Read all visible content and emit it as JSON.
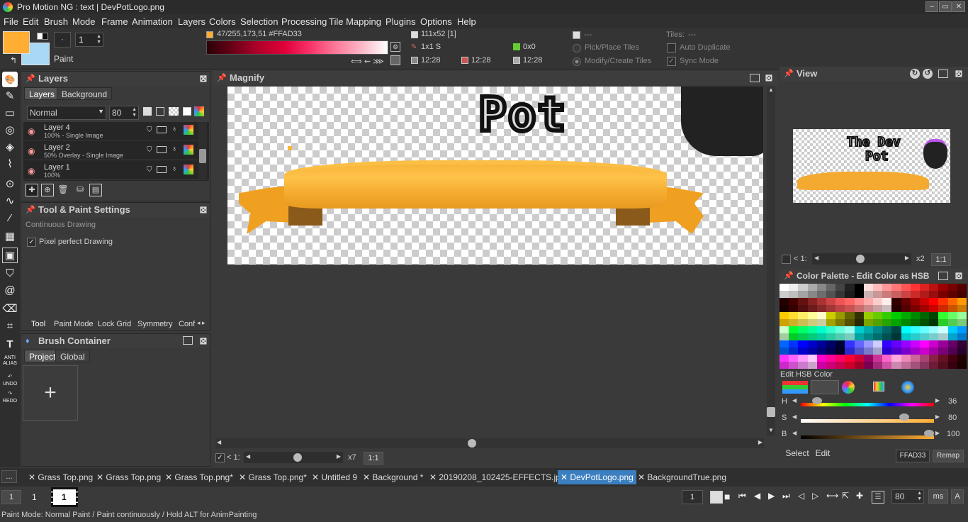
{
  "window": {
    "title": "Pro Motion NG : text | DevPotLogo.png"
  },
  "menu": [
    "File",
    "Edit",
    "Brush",
    "Mode",
    "Frame",
    "Animation",
    "Layers",
    "Colors",
    "Selection",
    "Processing",
    "Tile Mapping",
    "Plugins",
    "Options",
    "Help"
  ],
  "toolbar": {
    "mode_label": "Paint",
    "brush_size": "1",
    "color_info": "47/255,173,51 #FFAD33",
    "canvas_size": "111x52 [1]",
    "brush_info": "1x1 S",
    "position": "0x0",
    "time1": "12:28",
    "time2": "12:28",
    "time3": "12:28",
    "dash1": "---",
    "tiles_label": "Tiles:",
    "tiles_value": "---",
    "pick_place_tiles": "Pick/Place Tiles",
    "modify_create_tiles": "Modify/Create Tiles",
    "auto_duplicate": "Auto Duplicate",
    "sync_mode": "Sync Mode",
    "fg_color": "#FFAD33",
    "bg_color": "#A9D8F5"
  },
  "layers_panel": {
    "title": "Layers",
    "tabs": [
      "Layers",
      "Background"
    ],
    "blend_mode": "Normal",
    "opacity": "80",
    "layers": [
      {
        "name": "Layer 4",
        "detail": "100% - Single Image"
      },
      {
        "name": "Layer 2",
        "detail": "50% Overlay - Single Image"
      },
      {
        "name": "Layer 1",
        "detail": "100%"
      }
    ]
  },
  "tool_settings": {
    "title": "Tool & Paint Settings",
    "subtitle": "Continuous Drawing",
    "pixel_perfect": "Pixel perfect Drawing",
    "tabs": [
      "Tool",
      "Paint Mode",
      "Lock Grid",
      "Symmetry",
      "Conf"
    ]
  },
  "brush_container": {
    "title": "Brush Container",
    "tabs": [
      "Project",
      "Global"
    ],
    "add": "+"
  },
  "magnify": {
    "title": "Magnify",
    "zoom_label": "< 1:",
    "zoom_value": "x7",
    "ratio": "1:1",
    "canvas_text": "Pot"
  },
  "view_panel": {
    "title": "View",
    "zoom_label": "< 1:",
    "zoom_value": "x2",
    "ratio": "1:1",
    "preview_text_1": "The Dev",
    "preview_text_2": "Pot"
  },
  "color_palette": {
    "title": "Color Palette - Edit Color as HSB",
    "edit_label": "Edit HSB Color",
    "h_label": "H",
    "h_value": "36",
    "h_frac": 0.1,
    "s_label": "S",
    "s_value": "80",
    "s_frac": 0.8,
    "b_label": "B",
    "b_value": "100",
    "b_frac": 1.0,
    "select": "Select",
    "edit": "Edit",
    "hex": "FFAD33",
    "remap": "Remap"
  },
  "doc_tabs": [
    {
      "label": "Grass Top.png",
      "selected": false
    },
    {
      "label": "Grass Top.png",
      "selected": false
    },
    {
      "label": "Grass Top.png*",
      "selected": false
    },
    {
      "label": "Grass Top.png*",
      "selected": false
    },
    {
      "label": "Untitled 9",
      "selected": false
    },
    {
      "label": "Background *",
      "selected": false
    },
    {
      "label": "20190208_102425-EFFECTS.jpg*",
      "selected": false
    },
    {
      "label": "DevPotLogo.png",
      "selected": true
    },
    {
      "label": "BackgroundTrue.png",
      "selected": false
    }
  ],
  "doc_tabs_more": "...",
  "timeline": {
    "frame_left": "1",
    "frame_count": "1",
    "frame_thumb": "1",
    "frame_right": "1",
    "fps": "80",
    "ms": "ms",
    "a": "A"
  },
  "status": {
    "text": "Paint Mode: Normal Paint / Paint continuously / Hold ALT for AnimPainting"
  }
}
